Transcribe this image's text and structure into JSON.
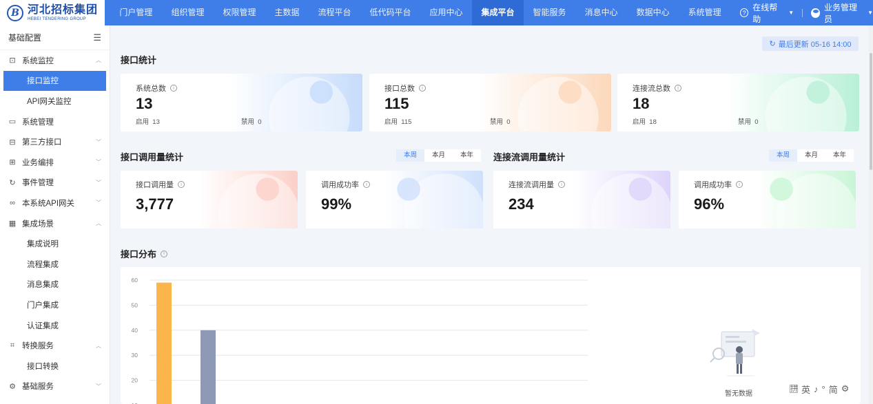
{
  "brand": {
    "name_cn": "河北招标集团",
    "name_en": "HEBEI TENDERING GROUP",
    "mark": "B"
  },
  "nav": {
    "items": [
      "门户管理",
      "组织管理",
      "权限管理",
      "主数据",
      "流程平台",
      "低代码平台",
      "应用中心",
      "集成平台",
      "智能服务",
      "消息中心",
      "数据中心",
      "系统管理"
    ],
    "active": "集成平台",
    "help": "在线帮助",
    "user": "业务管理员",
    "accent": "#3f7de8"
  },
  "sidebar": {
    "title": "基础配置",
    "items": [
      {
        "label": "系统监控",
        "icon": "monitor-icon",
        "glyph": "⊡",
        "expanded": true,
        "children": [
          "接口监控",
          "API网关监控"
        ],
        "active_child": "接口监控"
      },
      {
        "label": "系统管理",
        "icon": "window-icon",
        "glyph": "▭",
        "expanded": false,
        "children": []
      },
      {
        "label": "第三方接口",
        "icon": "plug-icon",
        "glyph": "⊟",
        "expanded": false,
        "children": [],
        "chevron": true
      },
      {
        "label": "业务编排",
        "icon": "flow-icon",
        "glyph": "⊞",
        "expanded": false,
        "children": [],
        "chevron": true
      },
      {
        "label": "事件管理",
        "icon": "event-icon",
        "glyph": "↻",
        "expanded": false,
        "children": [],
        "chevron": true
      },
      {
        "label": "本系统API网关",
        "icon": "link-icon",
        "glyph": "∞",
        "expanded": false,
        "children": [],
        "chevron": true
      },
      {
        "label": "集成场景",
        "icon": "scene-icon",
        "glyph": "▦",
        "expanded": true,
        "children": [
          "集成说明",
          "流程集成",
          "消息集成",
          "门户集成",
          "认证集成"
        ]
      },
      {
        "label": "转换服务",
        "icon": "convert-icon",
        "glyph": "⌗",
        "expanded": true,
        "children": [
          "接口转换"
        ]
      },
      {
        "label": "基础服务",
        "icon": "gear-icon",
        "glyph": "⚙",
        "expanded": false,
        "children": [],
        "chevron": true
      }
    ]
  },
  "update": {
    "label": "最后更新 05-16 14:00"
  },
  "interface_stats": {
    "title": "接口统计",
    "cards": [
      {
        "label": "系统总数",
        "value": "13",
        "enabled_label": "启用",
        "enabled": "13",
        "disabled_label": "禁用",
        "disabled": "0",
        "color": "#c6dcfb"
      },
      {
        "label": "接口总数",
        "value": "115",
        "enabled_label": "启用",
        "enabled": "115",
        "disabled_label": "禁用",
        "disabled": "0",
        "color": "#fcd8bb"
      },
      {
        "label": "连接流总数",
        "value": "18",
        "enabled_label": "启用",
        "enabled": "18",
        "disabled_label": "禁用",
        "disabled": "0",
        "color": "#b9f0d6"
      }
    ]
  },
  "call_stats": {
    "title": "接口调用量统计",
    "tabs": [
      "本周",
      "本月",
      "本年"
    ],
    "active_tab": "本周",
    "cards": [
      {
        "label": "接口调用量",
        "value": "3,777",
        "color": "#fbd0c8"
      },
      {
        "label": "调用成功率",
        "value": "99%",
        "color": "#cfe0fb"
      }
    ]
  },
  "flow_stats": {
    "title": "连接流调用量统计",
    "tabs": [
      "本周",
      "本月",
      "本年"
    ],
    "active_tab": "本周",
    "cards": [
      {
        "label": "连接流调用量",
        "value": "234",
        "color": "#ddd4fa"
      },
      {
        "label": "调用成功率",
        "value": "96%",
        "color": "#c9f5d6"
      }
    ]
  },
  "distribution": {
    "title": "接口分布",
    "empty_text": "暂无数据"
  },
  "chart_data": {
    "type": "bar",
    "y_ticks": [
      20,
      30,
      40,
      50,
      60
    ],
    "ylim": [
      10,
      60
    ],
    "values": [
      59,
      40
    ],
    "colors": [
      "#fcb54a",
      "#8e9ab5"
    ],
    "grid": true
  },
  "ime": {
    "glyphs": [
      "英",
      "♪",
      "°",
      "简",
      "⚙"
    ]
  }
}
